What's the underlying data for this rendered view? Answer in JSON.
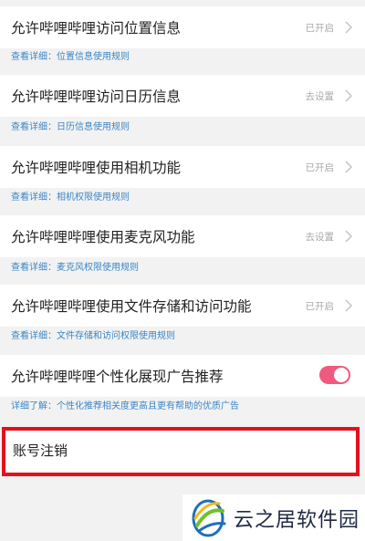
{
  "permissions": [
    {
      "title": "允许哔哩哔哩访问位置信息",
      "status": "已开启",
      "detail": "查看详细：位置信息使用规则"
    },
    {
      "title": "允许哔哩哔哩访问日历信息",
      "status": "去设置",
      "detail": "查看详细：日历信息使用规则"
    },
    {
      "title": "允许哔哩哔哩使用相机功能",
      "status": "已开启",
      "detail": "查看详细：相机权限使用规则"
    },
    {
      "title": "允许哔哩哔哩使用麦克风功能",
      "status": "去设置",
      "detail": "查看详细：麦克风权限使用规则"
    },
    {
      "title": "允许哔哩哔哩使用文件存储和访问功能",
      "status": "已开启",
      "detail": "查看详细：文件存储和访问权限使用规则"
    }
  ],
  "ad_personalization": {
    "title": "允许哔哩哔哩个性化展现广告推荐",
    "enabled": true,
    "detail": "详细了解：个性化推荐相关度更高且更有帮助的优质广告"
  },
  "account_cancel": {
    "label": "账号注销"
  },
  "watermark": {
    "text": "云之居软件园"
  },
  "colors": {
    "background": "#f2f2f2",
    "link": "#3b86c6",
    "toggle_on": "#f05a7e",
    "highlight_border": "#e4101d"
  },
  "icons": {
    "row_arrow": "chevron-right-icon",
    "watermark_logo": "yunzhiju-logo-icon"
  }
}
